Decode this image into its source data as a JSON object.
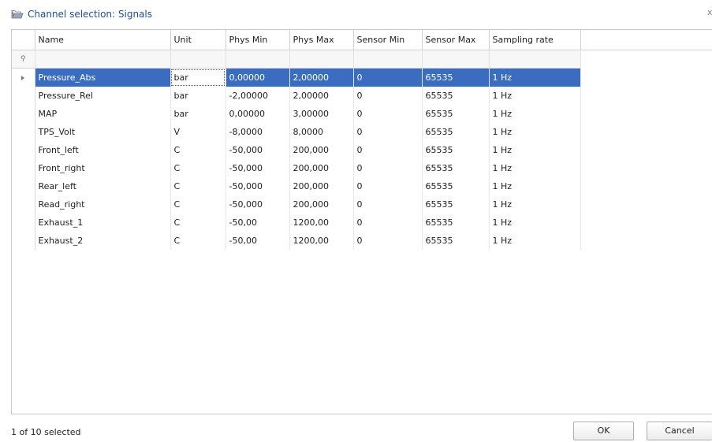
{
  "window": {
    "title": "Channel selection: Signals",
    "close_glyph": "x",
    "icon": "open-folder-icon"
  },
  "grid": {
    "columns": [
      "Name",
      "Unit",
      "Phys Min",
      "Phys Max",
      "Sensor Min",
      "Sensor Max",
      "Sampling rate"
    ],
    "filter_icon": "pin-icon",
    "selected_row_index": 0,
    "selection_color": "#3a6dbf",
    "rows": [
      {
        "name": "Pressure_Abs",
        "unit": "bar",
        "phys_min": "0,00000",
        "phys_max": "2,00000",
        "sensor_min": "0",
        "sensor_max": "65535",
        "sampling_rate": "1 Hz"
      },
      {
        "name": "Pressure_Rel",
        "unit": "bar",
        "phys_min": "-2,00000",
        "phys_max": "2,00000",
        "sensor_min": "0",
        "sensor_max": "65535",
        "sampling_rate": "1 Hz"
      },
      {
        "name": "MAP",
        "unit": "bar",
        "phys_min": "0,00000",
        "phys_max": "3,00000",
        "sensor_min": "0",
        "sensor_max": "65535",
        "sampling_rate": "1 Hz"
      },
      {
        "name": "TPS_Volt",
        "unit": "V",
        "phys_min": "-8,0000",
        "phys_max": "8,0000",
        "sensor_min": "0",
        "sensor_max": "65535",
        "sampling_rate": "1 Hz"
      },
      {
        "name": "Front_left",
        "unit": "C",
        "phys_min": "-50,000",
        "phys_max": "200,000",
        "sensor_min": "0",
        "sensor_max": "65535",
        "sampling_rate": "1 Hz"
      },
      {
        "name": "Front_right",
        "unit": "C",
        "phys_min": "-50,000",
        "phys_max": "200,000",
        "sensor_min": "0",
        "sensor_max": "65535",
        "sampling_rate": "1 Hz"
      },
      {
        "name": "Rear_left",
        "unit": "C",
        "phys_min": "-50,000",
        "phys_max": "200,000",
        "sensor_min": "0",
        "sensor_max": "65535",
        "sampling_rate": "1 Hz"
      },
      {
        "name": "Read_right",
        "unit": "C",
        "phys_min": "-50,000",
        "phys_max": "200,000",
        "sensor_min": "0",
        "sensor_max": "65535",
        "sampling_rate": "1 Hz"
      },
      {
        "name": "Exhaust_1",
        "unit": "C",
        "phys_min": "-50,00",
        "phys_max": "1200,00",
        "sensor_min": "0",
        "sensor_max": "65535",
        "sampling_rate": "1 Hz"
      },
      {
        "name": "Exhaust_2",
        "unit": "C",
        "phys_min": "-50,00",
        "phys_max": "1200,00",
        "sensor_min": "0",
        "sensor_max": "65535",
        "sampling_rate": "1 Hz"
      }
    ]
  },
  "footer": {
    "status": "1 of 10 selected",
    "ok_label": "OK",
    "cancel_label": "Cancel"
  }
}
